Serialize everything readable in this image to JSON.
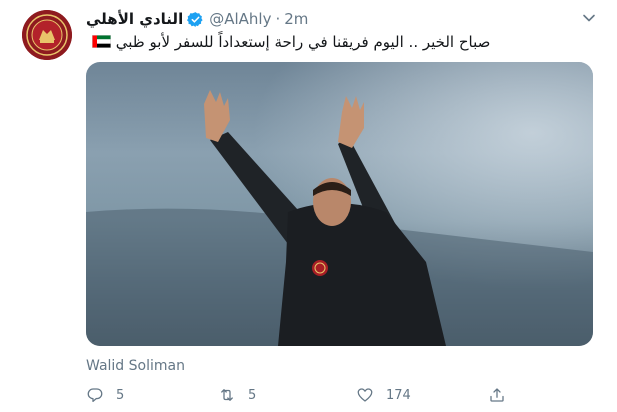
{
  "tweet": {
    "display_name": "النادي الأهلي",
    "handle": "@AlAhly",
    "separator": "·",
    "timestamp": "2m",
    "text": "صباح الخير .. اليوم فريقنا في راحة إستعداداً للسفر لأبو ظبي",
    "media_caption": "Walid Soliman",
    "reply_count": "5",
    "retweet_count": "5",
    "like_count": "174"
  },
  "icons": [
    "verified-badge-icon",
    "caret-down-icon",
    "uae-flag-icon",
    "reply-icon",
    "retweet-icon",
    "like-icon",
    "share-icon"
  ],
  "colors": {
    "verified": "#1da1f2",
    "secondary_text": "#657786",
    "avatar": "#8e1a1f"
  }
}
